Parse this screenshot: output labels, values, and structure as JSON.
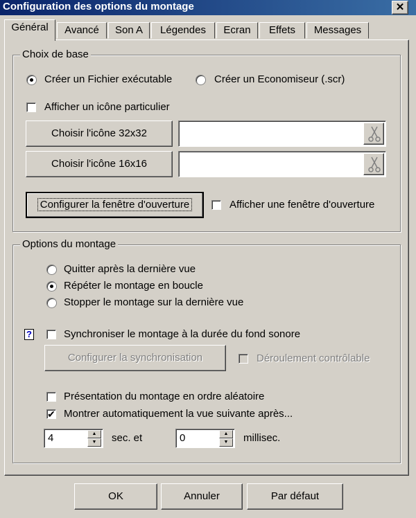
{
  "window": {
    "title": "Configuration des options du montage",
    "close_glyph": "✕"
  },
  "tabs": [
    {
      "label": "Général",
      "active": true
    },
    {
      "label": "Avancé"
    },
    {
      "label": "Son A"
    },
    {
      "label": "Légendes"
    },
    {
      "label": "Ecran"
    },
    {
      "label": "Effets"
    },
    {
      "label": "Messages"
    }
  ],
  "choix_de_base": {
    "legend": "Choix de base",
    "radio_executable": "Créer un Fichier exécutable",
    "radio_economiseur": "Créer un Economiseur (.scr)",
    "check_icone_particulier": "Afficher un icône particulier",
    "btn_icone_32": "Choisir l'icône 32x32",
    "btn_icone_16": "Choisir l'icône 16x16",
    "field_icone_32": "",
    "field_icone_16": "",
    "btn_fenetre_ouverture": "Configurer la fenêtre d'ouverture",
    "check_fenetre_ouverture": "Afficher une fenêtre d'ouverture"
  },
  "options_montage": {
    "legend": "Options du montage",
    "radio_quitter": "Quitter après la dernière vue",
    "radio_repeter": "Répéter le montage en boucle",
    "radio_stopper": "Stopper le montage sur la dernière vue",
    "help_glyph": "?",
    "check_synchroniser": "Synchroniser le montage à la durée du fond sonore",
    "btn_config_synchro": "Configurer la synchronisation",
    "check_deroulement": "Déroulement contrôlable",
    "check_aleatoire": "Présentation du montage en ordre aléatoire",
    "check_montrer_auto": "Montrer automatiquement la vue suivante après...",
    "sec_value": "4",
    "sec_label": "sec. et",
    "millisec_value": "0",
    "millisec_label": "millisec."
  },
  "footer": {
    "ok": "OK",
    "annuler": "Annuler",
    "par_defaut": "Par défaut"
  },
  "colors": {
    "face": "#d4d0c8",
    "title_start": "#0a246a",
    "title_end": "#3a6ea5"
  }
}
